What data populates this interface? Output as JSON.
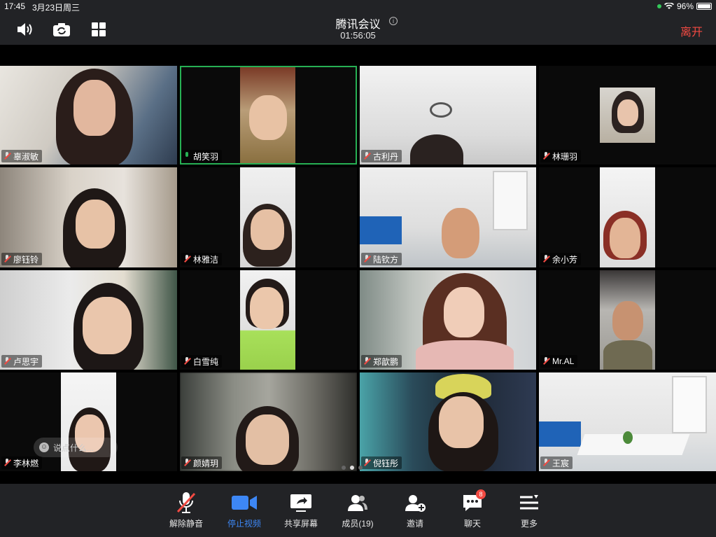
{
  "status_bar": {
    "time": "17:45",
    "date": "3月23日周三",
    "battery": "96%"
  },
  "header": {
    "title": "腾讯会议",
    "timer": "01:56:05",
    "leave_label": "离开"
  },
  "colors": {
    "accent": "#3d87f5",
    "leave": "#f24a42",
    "speaking": "#27b054",
    "toolbar_bg": "#222326"
  },
  "participants": [
    {
      "name": "辜淑敏",
      "mic": "muted"
    },
    {
      "name": "胡笑羽",
      "mic": "on"
    },
    {
      "name": "古利丹",
      "mic": "muted"
    },
    {
      "name": "林珊羽",
      "mic": "muted"
    },
    {
      "name": "廖钰铃",
      "mic": "muted"
    },
    {
      "name": "林雅洁",
      "mic": "muted"
    },
    {
      "name": "陆钦方",
      "mic": "muted"
    },
    {
      "name": "余小芳",
      "mic": "muted"
    },
    {
      "name": "卢思宇",
      "mic": "muted"
    },
    {
      "name": "白雪纯",
      "mic": "muted"
    },
    {
      "name": "郑歆鹏",
      "mic": "muted"
    },
    {
      "name": "Mr.AL",
      "mic": "muted"
    },
    {
      "name": "李林燃",
      "mic": "muted"
    },
    {
      "name": "颜婧玥",
      "mic": "muted"
    },
    {
      "name": "倪钰彤",
      "mic": "muted"
    },
    {
      "name": "王宸",
      "mic": "muted"
    }
  ],
  "chat_input": {
    "placeholder": "说点什么..."
  },
  "pager": {
    "pages": 3,
    "current": 2
  },
  "toolbar": {
    "unmute": "解除静音",
    "stop_video": "停止视频",
    "share_screen": "共享屏幕",
    "members": "成员(19)",
    "invite": "邀请",
    "chat": "聊天",
    "chat_badge": "8",
    "more": "更多"
  },
  "icons": [
    "speaker-icon",
    "camera-switch-icon",
    "grid-view-icon",
    "info-icon",
    "mic-muted-icon",
    "video-camera-icon",
    "share-screen-icon",
    "members-icon",
    "invite-icon",
    "chat-icon",
    "more-icon"
  ]
}
